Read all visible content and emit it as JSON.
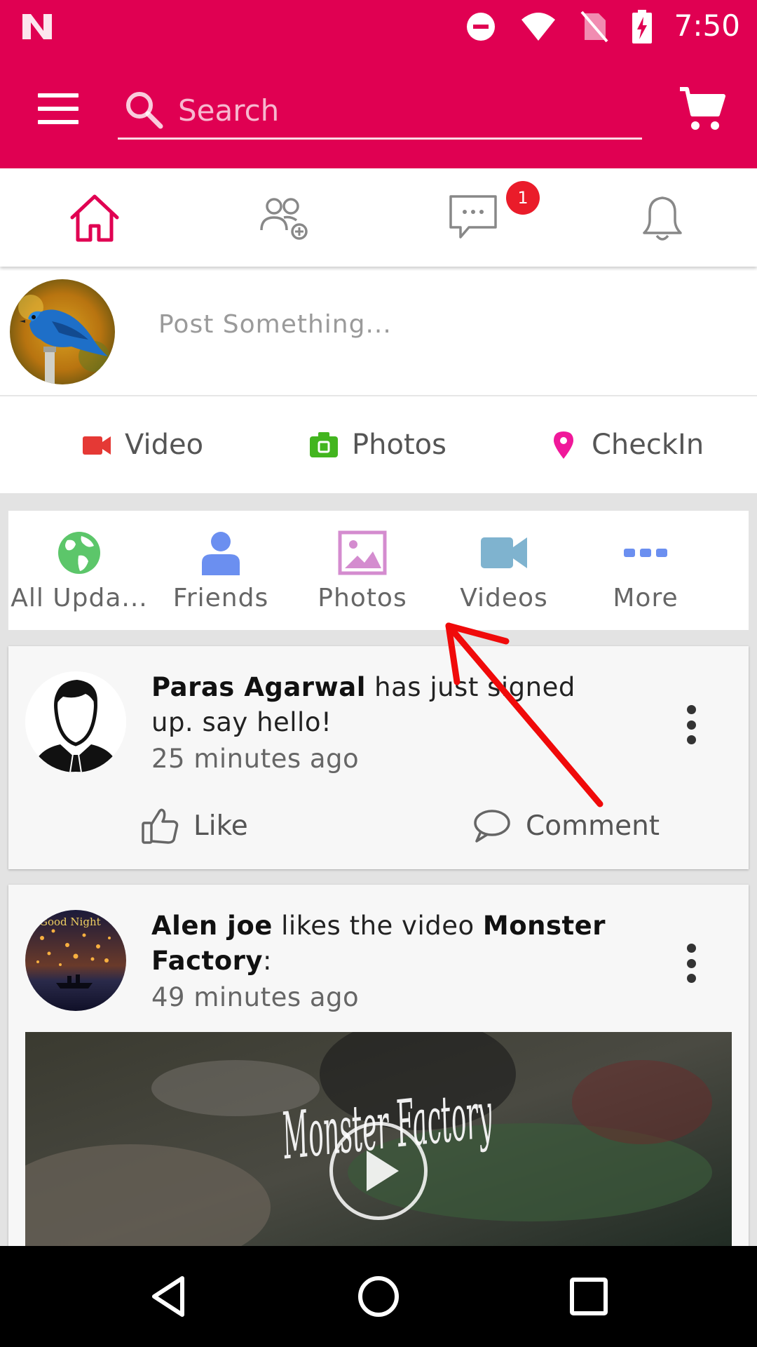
{
  "status_bar": {
    "time": "7:50",
    "icons": [
      "notification-n-icon",
      "do-not-disturb-icon",
      "wifi-icon",
      "no-sim-icon",
      "battery-charging-icon"
    ]
  },
  "app_bar": {
    "search_placeholder": "Search",
    "brand_color": "#e00052"
  },
  "tabs": [
    {
      "name": "home",
      "icon": "home-icon",
      "active": true
    },
    {
      "name": "friend-requests",
      "icon": "add-friends-icon",
      "active": false
    },
    {
      "name": "messages",
      "icon": "chat-icon",
      "active": false
    },
    {
      "name": "notifications",
      "icon": "bell-icon",
      "active": false,
      "badge": "1"
    }
  ],
  "composer": {
    "placeholder": "Post Something...",
    "actions": [
      {
        "label": "Video",
        "icon": "video-camera-icon",
        "color": "#e53935"
      },
      {
        "label": "Photos",
        "icon": "camera-icon",
        "color": "#43b51f"
      },
      {
        "label": "CheckIn",
        "icon": "location-pin-icon",
        "color": "#f0189a"
      }
    ]
  },
  "filters": [
    {
      "label": "All Upda...",
      "icon": "globe-icon",
      "color": "#5cc66a"
    },
    {
      "label": "Friends",
      "icon": "person-icon",
      "color": "#6b8ff0"
    },
    {
      "label": "Photos",
      "icon": "image-icon",
      "color": "#d48ccf"
    },
    {
      "label": "Videos",
      "icon": "video-icon",
      "color": "#7fb3cf"
    },
    {
      "label": "More",
      "icon": "more-dots-icon",
      "color": "#6b8ff0"
    }
  ],
  "feed": [
    {
      "author": "Paras Agarwal",
      "text": " has just signed up. say hello!",
      "time": "25 minutes ago",
      "like_label": "Like",
      "comment_label": "Comment"
    },
    {
      "author": "Alen joe",
      "text_mid": " likes the video ",
      "target": "Monster Factory",
      "text_end": ":",
      "time": "49 minutes ago",
      "avatar_text": "Good Night",
      "video_title": "Monster Factory"
    }
  ]
}
